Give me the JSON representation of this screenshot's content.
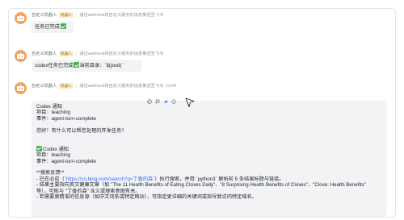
{
  "sender": {
    "name": "自定义机器人",
    "tag": "机器人",
    "via": "通过webhook将自定义服务的消息推送至飞书"
  },
  "messages": [
    {
      "text": "任务已完成"
    },
    {
      "text_before": "codex任务已完成",
      "text_after": "当前目录：`$(pwd)`"
    },
    {
      "time": "13:04"
    }
  ],
  "card": {
    "title": "Codex 通知",
    "project": "项目：teaching",
    "event": "事件：agent-turn-complete",
    "greeting": "您好！有什么可以帮您处理的开发任务?",
    "title2": "Codex 通知",
    "project2": "项目：teaching",
    "event2": "事件：agent-turn-complete",
    "feedback_heading": "**搜索反馈**",
    "line1_prefix": "- 已在必应（",
    "line1_link": "`https://cn.bing.com/search?q=丁香的森`",
    "line1_suffix": "）执行搜索，并用 `python3` 解析前 5 条结果标题与链接。",
    "line2": "- 结果主要指向英文健康文章（如 \"The 11 Health Benefits of Eating Cloves Daily\"、\"8 Surprising Health Benefits of Cloves\"、\"Clove: Health Benefits\"",
    "line3": "  等），可能与 \"丁香的森\" 含义或搜索意图有关。",
    "line4": "- 若需要更精准的信息源（如中文词条或特定网站），可指定更详细的关键词或指导我访问特定域名。"
  },
  "icons": {
    "avatar": "robot-icon",
    "toolbar": [
      "reaction-icon",
      "reply-icon",
      "forward-icon",
      "more-icon"
    ]
  }
}
